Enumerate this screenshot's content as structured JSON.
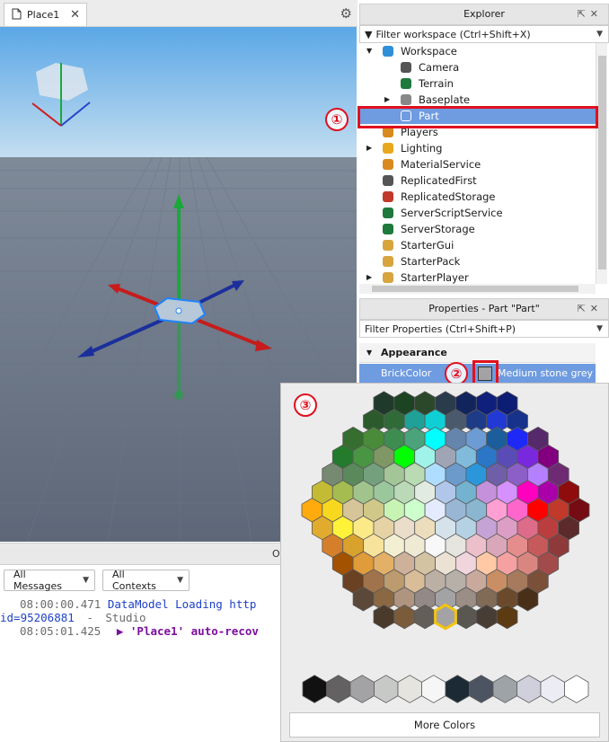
{
  "tab": {
    "label": "Place1",
    "close": "✕"
  },
  "output": {
    "title": "O",
    "filters": [
      "All Messages",
      "All Contexts"
    ],
    "lines": [
      {
        "ts": "08:00:00.471",
        "text": "DataModel Loading http"
      },
      {
        "prefix": "id=95206881",
        "sep": "-",
        "text": "Studio"
      },
      {
        "ts": "08:05:01.425",
        "text": "'Place1' auto-recov"
      }
    ]
  },
  "explorer": {
    "title": "Explorer",
    "filter_placeholder": "Filter workspace (Ctrl+Shift+X)",
    "items": [
      {
        "label": "Workspace",
        "indent": 0,
        "expanded": true,
        "icon": "workspace-icon",
        "color": "#2f8fd8"
      },
      {
        "label": "Camera",
        "indent": 1,
        "icon": "camera-icon",
        "color": "#555555"
      },
      {
        "label": "Terrain",
        "indent": 1,
        "icon": "terrain-icon",
        "color": "#1e7a3c"
      },
      {
        "label": "Baseplate",
        "indent": 1,
        "collapsed": true,
        "icon": "part-icon",
        "color": "#888888"
      },
      {
        "label": "Part",
        "indent": 1,
        "selected": true,
        "icon": "part-icon",
        "color": "#ffffff"
      },
      {
        "label": "Players",
        "indent": 0,
        "icon": "players-icon",
        "color": "#d88a1e"
      },
      {
        "label": "Lighting",
        "indent": 0,
        "collapsed": true,
        "icon": "lighting-icon",
        "color": "#e8a81e"
      },
      {
        "label": "MaterialService",
        "indent": 0,
        "icon": "material-service-icon",
        "color": "#d88a1e"
      },
      {
        "label": "ReplicatedFirst",
        "indent": 0,
        "icon": "replicated-first-icon",
        "color": "#555555"
      },
      {
        "label": "ReplicatedStorage",
        "indent": 0,
        "icon": "replicated-storage-icon",
        "color": "#c0392b"
      },
      {
        "label": "ServerScriptService",
        "indent": 0,
        "icon": "server-script-service-icon",
        "color": "#1e7a3c"
      },
      {
        "label": "ServerStorage",
        "indent": 0,
        "icon": "server-storage-icon",
        "color": "#1e7a3c"
      },
      {
        "label": "StarterGui",
        "indent": 0,
        "icon": "starter-gui-icon",
        "color": "#d8a43e"
      },
      {
        "label": "StarterPack",
        "indent": 0,
        "icon": "starter-pack-icon",
        "color": "#d8a43e"
      },
      {
        "label": "StarterPlayer",
        "indent": 0,
        "collapsed": true,
        "icon": "starter-player-icon",
        "color": "#d8a43e"
      }
    ]
  },
  "properties": {
    "title": "Properties - Part \"Part\"",
    "filter_placeholder": "Filter Properties (Ctrl+Shift+P)",
    "section": "Appearance",
    "rows": [
      {
        "name": "BrickColor",
        "value": "Medium stone grey",
        "swatch": "#a3a2a5"
      }
    ]
  },
  "callouts": [
    "①",
    "②",
    "③"
  ],
  "picker": {
    "more_colors_label": "More Colors",
    "selected_color": "#a3a2a5",
    "hex_rows": [
      [
        "#1f3a2a",
        "#1c4322",
        "#2c482a",
        "#2a3b4c",
        "#12245c",
        "#0f1f7c",
        "#0d1d73"
      ],
      [
        "#2c5a2c",
        "#2e6b36",
        "#20a197",
        "#0fcfd4",
        "#4a596b",
        "#1d3b86",
        "#223ad5",
        "#16328a"
      ],
      [
        "#356e2f",
        "#4a8b3a",
        "#3d8c50",
        "#4aa37a",
        "#00ffff",
        "#6585ad",
        "#6d9bd3",
        "#1b5e9b",
        "#1e29f8",
        "#56296b"
      ],
      [
        "#237b2b",
        "#4a9543",
        "#7e9764",
        "#00ff00",
        "#9ff3e9",
        "#a0a5b5",
        "#80bbdb",
        "#2b76c6",
        "#5a4cb6",
        "#7a28dd",
        "#820080"
      ],
      [
        "#758a70",
        "#5a8a5c",
        "#74a07e",
        "#a3c597",
        "#b8dbb3",
        "#afddff",
        "#6c9bcb",
        "#2b96d9",
        "#6f5fa8",
        "#8c5fc6",
        "#b480ff",
        "#6e2b73"
      ],
      [
        "#c4bb34",
        "#a5bc50",
        "#a1c48c",
        "#9bc79d",
        "#b9d9b7",
        "#e2ebe1",
        "#b1c7ea",
        "#74b3d0",
        "#c591db",
        "#d591ff",
        "#ff00bf",
        "#aa00aa",
        "#8e0c0c"
      ],
      [
        "#ffab0d",
        "#f7d81e",
        "#d7c59a",
        "#d0c888",
        "#c8f4b3",
        "#ccffcc",
        "#e4ebff",
        "#99b6d5",
        "#8bb6cf",
        "#ff9fd3",
        "#ff66cc",
        "#ff0000",
        "#c0392b",
        "#750c13"
      ],
      [
        "#e1ac2d",
        "#fff239",
        "#fcea89",
        "#e6d3a5",
        "#eadeca",
        "#ecdebc",
        "#d5e2e9",
        "#b4d2e4",
        "#c5a3d6",
        "#dd9ec6",
        "#dc6c8a",
        "#bb3e3e",
        "#5c2a2a"
      ],
      [
        "#d67f2b",
        "#d9a22c",
        "#f7e39c",
        "#f2efd2",
        "#efead4",
        "#f8f8f8",
        "#e5e4df",
        "#ecc0cb",
        "#d9a7b9",
        "#e58c8c",
        "#c65a5a",
        "#8e3a3a"
      ],
      [
        "#a35200",
        "#e09b3a",
        "#e2b167",
        "#cdb19a",
        "#d3c3a3",
        "#ebe2d4",
        "#f1d5dc",
        "#ffc9a6",
        "#f5a1a1",
        "#da8680",
        "#a34b4b"
      ],
      [
        "#6b4123",
        "#a1734c",
        "#bc9b6f",
        "#d9bc98",
        "#bcb0a4",
        "#b6b0a9",
        "#c8a99c",
        "#c98e64",
        "#a67a5c",
        "#7b5038"
      ],
      [
        "#5c4838",
        "#8a6842",
        "#af9580",
        "#938987",
        "#a3a2a5",
        "#9a8e86",
        "#816b57",
        "#6b4a2c",
        "#4a2f18"
      ],
      [
        "#4a3a2c",
        "#7a5c3a",
        "#635e58",
        "#a3a2a5",
        "#5a5650",
        "#473d35",
        "#5c3a12"
      ]
    ],
    "gray_row": [
      "#111111",
      "#636162",
      "#a3a2a5",
      "#c7c9c7",
      "#e5e4df",
      "#f6f6f6",
      "#1b2a35",
      "#4d5461",
      "#9ea3a8",
      "#d0d0dc",
      "#ececf4",
      "#ffffff"
    ]
  }
}
